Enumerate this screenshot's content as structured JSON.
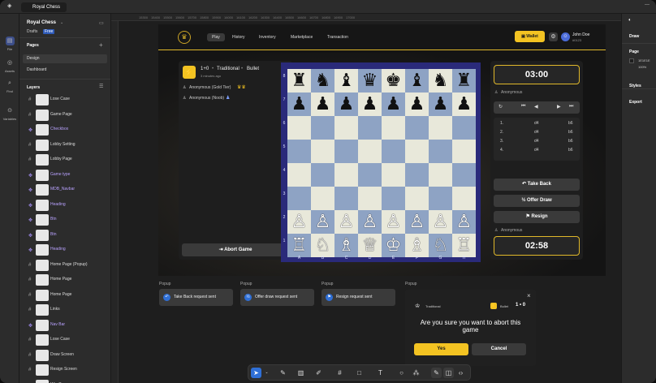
{
  "window": {
    "tab_title": "Royal Chess"
  },
  "rail": [
    {
      "label": "File",
      "icon": "file-icon"
    },
    {
      "label": "Assets",
      "icon": "assets-icon"
    },
    {
      "label": "Find",
      "icon": "search-icon"
    },
    {
      "label": "Variables",
      "icon": "variables-icon"
    }
  ],
  "left_panel": {
    "project": "Royal Chess",
    "drafts": "Drafts",
    "plan": "Free",
    "pages_title": "Pages",
    "pages": [
      "Design",
      "Dashboard"
    ],
    "layers_title": "Layers",
    "layers": [
      {
        "name": "Lose Case",
        "purple": false
      },
      {
        "name": "Game Page",
        "purple": false
      },
      {
        "name": "Checkbox",
        "purple": true
      },
      {
        "name": "Lobby Setting",
        "purple": false
      },
      {
        "name": "Lobby Page",
        "purple": false
      },
      {
        "name": "Game type",
        "purple": true
      },
      {
        "name": "MDB_Navbar",
        "purple": true
      },
      {
        "name": "Heading",
        "purple": true
      },
      {
        "name": "Btn",
        "purple": true
      },
      {
        "name": "Btn",
        "purple": true
      },
      {
        "name": "Heading",
        "purple": true
      },
      {
        "name": "Home Page (Popup)",
        "purple": false
      },
      {
        "name": "Home Page",
        "purple": false
      },
      {
        "name": "Home Page",
        "purple": false
      },
      {
        "name": "Links",
        "purple": false
      },
      {
        "name": "Nav Bar",
        "purple": true
      },
      {
        "name": "Lose Case",
        "purple": false
      },
      {
        "name": "Draw Screen",
        "purple": false
      },
      {
        "name": "Resign Screen",
        "purple": false
      },
      {
        "name": "Win Case",
        "purple": false
      }
    ]
  },
  "right_panel": {
    "draw": "Draw",
    "page": "Page",
    "page_color": "1E1E1E",
    "page_opacity": "100%",
    "styles": "Styles",
    "export": "Export"
  },
  "ruler": [
    "15300",
    "15400",
    "15500",
    "15600",
    "15700",
    "15800",
    "15900",
    "16000",
    "16100",
    "16200",
    "16300",
    "16400",
    "16500",
    "16600",
    "16700",
    "16800",
    "16900",
    "17000"
  ],
  "nav": {
    "items": [
      "Play",
      "History",
      "Inventory",
      "Marketplace",
      "Transaction"
    ],
    "active": "Play",
    "wallet": "Wallet",
    "user_name": "John Doe",
    "user_id": "#0123"
  },
  "game": {
    "time_control": "1+0",
    "mode": "Traditional",
    "speed": "Bullet",
    "time_ago": "3 minutes ago",
    "player1": "Anonymous (Gold Tier)",
    "player2": "Anonymous (Noob)",
    "abort_label": "Abort Game"
  },
  "clocks": {
    "top": "03:00",
    "top_player": "Anonymous",
    "bottom": "02:58",
    "bottom_player": "Anonymous"
  },
  "moves": [
    {
      "n": "1.",
      "w": "d4",
      "b": "b6"
    },
    {
      "n": "2.",
      "w": "d4",
      "b": "b6"
    },
    {
      "n": "3.",
      "w": "d4",
      "b": "b6"
    },
    {
      "n": "4.",
      "w": "d4",
      "b": "b6"
    }
  ],
  "actions": {
    "take_back": "Take Back",
    "offer_draw": "Offer Draw",
    "draw_half": "½",
    "resign": "Resign"
  },
  "board": {
    "ranks": [
      "8",
      "7",
      "6",
      "5",
      "4",
      "3",
      "2",
      "1"
    ],
    "files": [
      "A",
      "B",
      "C",
      "D",
      "E",
      "F",
      "G",
      "H"
    ],
    "rows": [
      [
        "♜",
        "♞",
        "♝",
        "♛",
        "♚",
        "♝",
        "♞",
        "♜"
      ],
      [
        "♟",
        "♟",
        "♟",
        "♟",
        "♟",
        "♟",
        "♟",
        "♟"
      ],
      [
        "",
        "",
        "",
        "",
        "",
        "",
        "",
        ""
      ],
      [
        "",
        "",
        "",
        "",
        "",
        "",
        "",
        ""
      ],
      [
        "",
        "",
        "",
        "",
        "",
        "",
        "",
        ""
      ],
      [
        "",
        "",
        "",
        "",
        "",
        "",
        "",
        ""
      ],
      [
        "♙",
        "♙",
        "♙",
        "♙",
        "♙",
        "♙",
        "♙",
        "♙"
      ],
      [
        "♖",
        "♘",
        "♗",
        "♕",
        "♔",
        "♗",
        "♘",
        "♖"
      ]
    ]
  },
  "popups": [
    {
      "label": "Popup",
      "text": "Take Back request sent"
    },
    {
      "label": "Popup",
      "text": "Offer draw request sent"
    },
    {
      "label": "Popup",
      "text": "Resign request sent"
    }
  ],
  "modal": {
    "label": "Popup",
    "mode": "Traditional",
    "speed": "Bullet",
    "time_control": "1 • 0",
    "question": "Are you sure you want to abort this game",
    "yes": "Yes",
    "cancel": "Cancel",
    "close": "×"
  },
  "colors": {
    "accent": "#F3C322",
    "board_dark": "#8EA3C4",
    "board_light": "#E8E8DA",
    "board_border": "#2A2A7A"
  }
}
